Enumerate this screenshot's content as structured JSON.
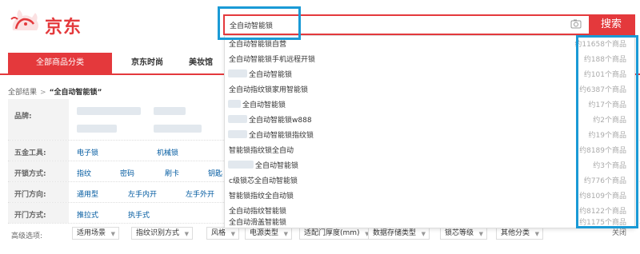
{
  "header": {
    "brand": "京东",
    "search_value": "全自动智能锁",
    "search_button": "搜索"
  },
  "nav": {
    "category_label": "全部商品分类",
    "items": [
      "京东时尚",
      "美妆馆"
    ]
  },
  "breadcrumb": {
    "root": "全部结果",
    "sep": ">",
    "current": "“全自动智能锁”"
  },
  "filters": {
    "brand_label": "品牌:",
    "hardware_label": "五金工具:",
    "hardware_values": [
      "电子锁",
      "机械锁"
    ],
    "unlock_label": "开锁方式:",
    "unlock_values": [
      "指纹",
      "密码",
      "刷卡",
      "钥匙"
    ],
    "direction_label": "开门方向:",
    "direction_values": [
      "通用型",
      "左手内开",
      "左手外开"
    ],
    "open_label": "开门方式:",
    "open_values": [
      "推拉式",
      "执手式"
    ],
    "advanced_label": "高级选项:",
    "advanced_options": [
      "适用场景",
      "指纹识别方式",
      "风格",
      "电源类型",
      "适配门厚度(mm)",
      "数据存储类型",
      "锁芯等级",
      "其他分类"
    ]
  },
  "suggestions": [
    {
      "text": "全自动智能锁自营",
      "count": "约11658个商品"
    },
    {
      "text": "全自动智能锁手机远程开锁",
      "count": "约188个商品"
    },
    {
      "text": "全自动智能锁",
      "count": "约101个商品"
    },
    {
      "text": "全自动指纹锁家用智能锁",
      "count": "约6387个商品"
    },
    {
      "text": "全自动智能锁",
      "count": "约17个商品"
    },
    {
      "text": "全自动智能锁w888",
      "count": "约2个商品"
    },
    {
      "text": "全自动智能锁指纹锁",
      "count": "约19个商品"
    },
    {
      "text": "智能锁指纹锁全自动",
      "count": "约8189个商品"
    },
    {
      "text": "全自动智能锁",
      "count": "约3个商品"
    },
    {
      "text": "c级锁芯全自动智能锁",
      "count": "约776个商品"
    },
    {
      "text": "智能锁指纹全自动锁",
      "count": "约8109个商品"
    },
    {
      "text": "全自动指纹智能锁",
      "count": "约8122个商品"
    },
    {
      "text": "全自动滑盖智能锁",
      "count": "约1175个商品"
    }
  ],
  "dropdown_close": "关闭",
  "colors": {
    "accent": "#e4393c",
    "highlight": "#1a9ad6"
  }
}
